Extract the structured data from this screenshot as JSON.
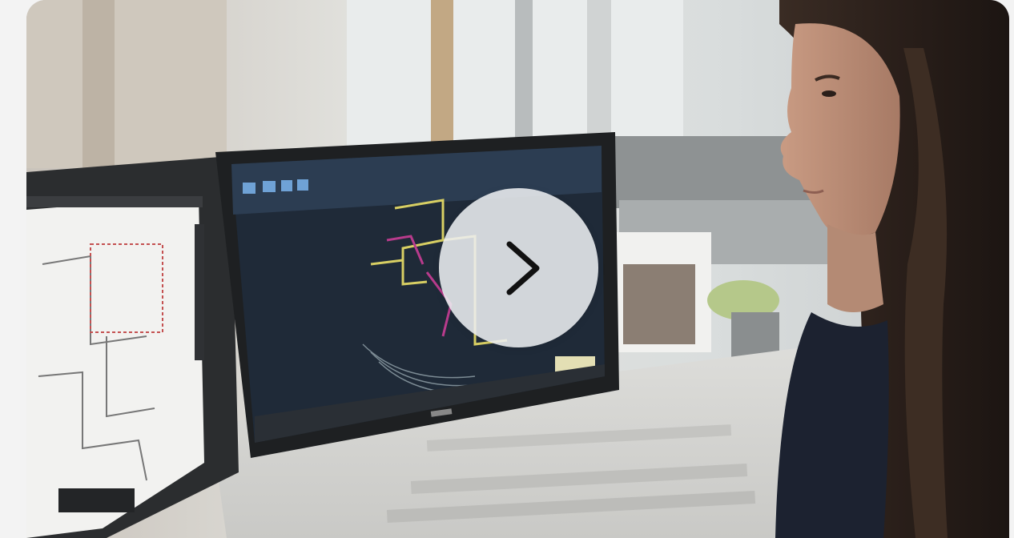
{
  "video": {
    "thumbnail_alt": "",
    "play_icon": "chevron-right-icon",
    "colors": {
      "card_bg": "#cfd3d4",
      "play_button_bg": "#eceef0",
      "play_icon": "#111111",
      "cad_background": "#1f2a38",
      "cad_yellow": "#d8cf63",
      "cad_magenta": "#b83b8c"
    }
  }
}
